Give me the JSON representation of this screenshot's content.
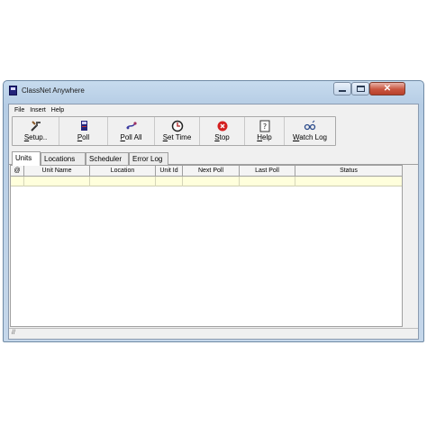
{
  "window": {
    "title": "ClassNet Anywhere"
  },
  "menu": [
    "File",
    "Insert",
    "Help"
  ],
  "toolbar": [
    {
      "label": "Setup..",
      "icon": "setup-icon"
    },
    {
      "label": "Poll",
      "icon": "poll-icon"
    },
    {
      "label": "Poll All",
      "icon": "poll-all-icon"
    },
    {
      "label": "Set Time",
      "icon": "set-time-icon"
    },
    {
      "label": "Stop",
      "icon": "stop-icon"
    },
    {
      "label": "Help",
      "icon": "help-icon"
    },
    {
      "label": "Watch Log",
      "icon": "watch-log-icon"
    }
  ],
  "tabs": [
    "Units",
    "Locations",
    "Scheduler",
    "Error Log"
  ],
  "active_tab": "Units",
  "table": {
    "columns": [
      "@",
      "Unit Name",
      "Location",
      "Unit Id",
      "Next Poll",
      "Last Poll",
      "Status"
    ],
    "rows": [
      [
        "",
        "",
        "",
        "",
        "",
        "",
        ""
      ]
    ]
  },
  "status": {
    "text": "//"
  },
  "colors": {
    "row_highlight": "#ffffdc",
    "close_button": "#c9553f",
    "app_icon": "#23247a"
  }
}
